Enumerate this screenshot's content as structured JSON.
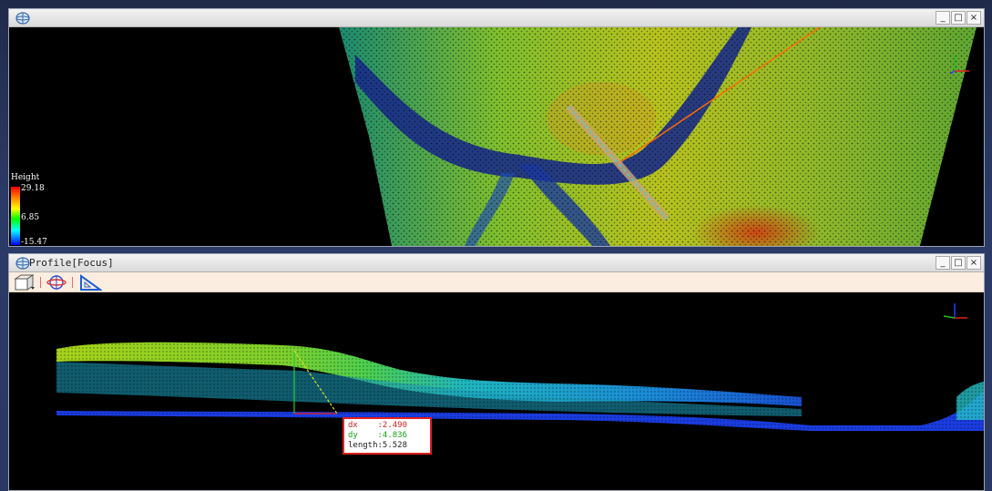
{
  "top_window": {
    "title": "",
    "legend": {
      "title": "Height",
      "max": "29.18",
      "mid": "6.85",
      "min": "-15.47"
    }
  },
  "bottom_window": {
    "title": "Profile[Focus]",
    "measurement": {
      "dx": "dx    :2.490",
      "dy": "dy    :4.836",
      "length": "length:5.528"
    }
  },
  "window_controls": {
    "minimize": "_",
    "maximize": "□",
    "close": "×"
  },
  "colors": {
    "measure_border": "#e02020",
    "dx_text": "#d02020",
    "dy_text": "#18a018",
    "length_text": "#202020",
    "section_line": "#ff6a00",
    "toolbar_bg": "#fbeee0"
  },
  "icons": {
    "app": "globe-icon",
    "tool1": "cube-view-icon",
    "tool2": "orbit-icon",
    "tool3": "ruler-triangle-icon"
  }
}
